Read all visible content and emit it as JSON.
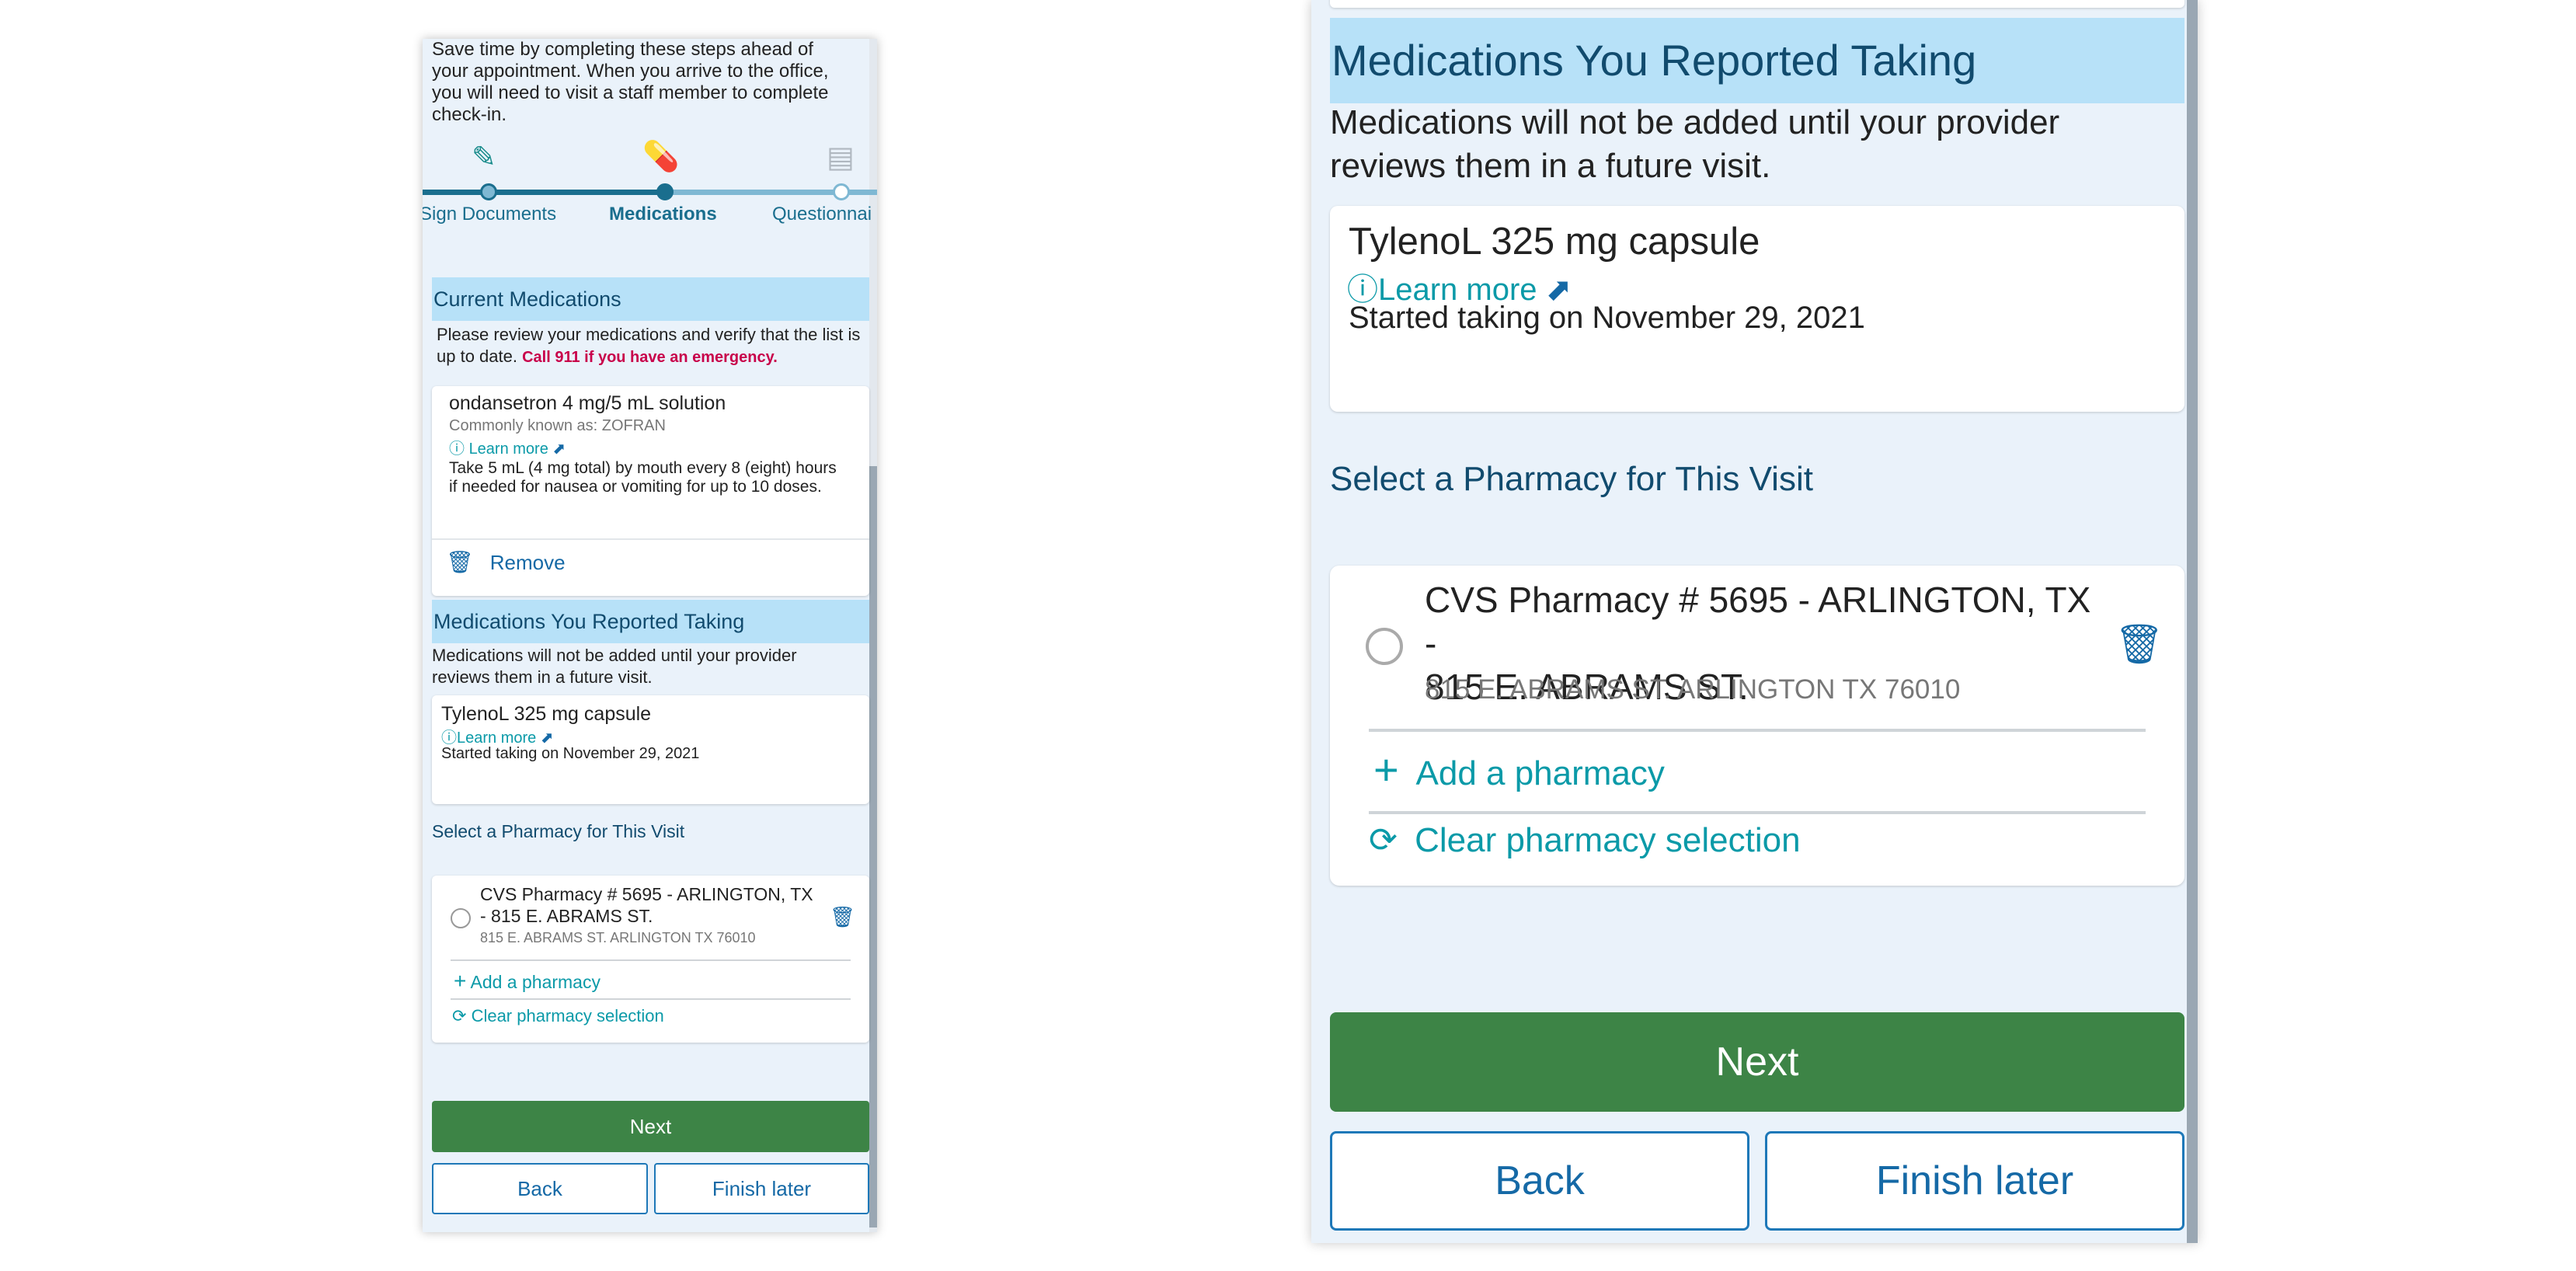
{
  "intro_text": "Save time by completing these steps ahead of your appointment. When you arrive to the office, you will need to visit a staff member to complete check-in.",
  "steps": [
    {
      "label": "Sign Documents",
      "icon": "pen-icon"
    },
    {
      "label": "Medications",
      "icon": "pills-icon"
    },
    {
      "label": "Questionnai",
      "icon": "clipboard-icon"
    }
  ],
  "current_meds": {
    "header": "Current Medications",
    "instructions": "Please review your medications and verify that the list is up to date.",
    "emergency": "Call 911 if you have an emergency.",
    "item": {
      "name": "ondansetron 4 mg/5 mL solution",
      "known_as": "Commonly known as: ZOFRAN",
      "learn_more": "Learn more",
      "directions": "Take 5 mL (4 mg total) by mouth every 8 (eight) hours if needed for nausea or vomiting for up to 10 doses.",
      "remove": "Remove"
    }
  },
  "reported_meds": {
    "header": "Medications You Reported Taking",
    "note": "Medications will not be added until your provider reviews them in a future visit.",
    "item": {
      "name": "TylenoL 325 mg capsule",
      "learn_more": "Learn more",
      "started": "Started taking on November 29, 2021"
    }
  },
  "pharmacy": {
    "header": "Select a Pharmacy for This Visit",
    "name": "CVS Pharmacy # 5695 - ARLINGTON, TX - 815 E. ABRAMS ST.",
    "name_line1": "CVS Pharmacy # 5695 - ARLINGTON, TX -",
    "name_line2": "815 E. ABRAMS ST.",
    "address": "815 E. ABRAMS ST. ARLINGTON TX 76010",
    "add": "Add a pharmacy",
    "clear": "Clear pharmacy selection"
  },
  "buttons": {
    "next": "Next",
    "back": "Back",
    "finish_later": "Finish later"
  },
  "colors": {
    "accent_green": "#3d8446",
    "header_bg": "#b7e1f8",
    "link_teal": "#0b9aa8",
    "emergency_red": "#c8004a"
  }
}
